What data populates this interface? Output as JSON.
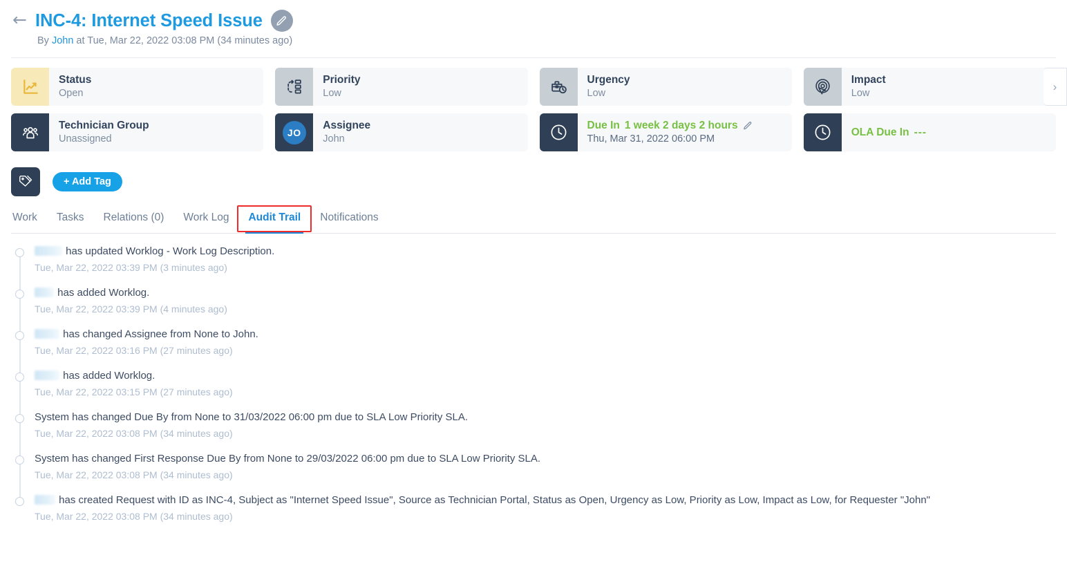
{
  "header": {
    "back_icon": "arrow-left-icon",
    "title": "INC-4: Internet Speed Issue",
    "edit_icon": "pencil-icon",
    "byline_prefix": "By ",
    "byline_author": "John",
    "byline_suffix": " at Tue, Mar 22, 2022 03:08 PM (34 minutes ago)"
  },
  "cards": {
    "row1": [
      {
        "icon": "chart-line-icon",
        "label": "Status",
        "value": "Open",
        "icon_bg": "ic-yellow"
      },
      {
        "icon": "priority-flow-icon",
        "label": "Priority",
        "value": "Low",
        "icon_bg": "ic-grey"
      },
      {
        "icon": "briefcase-clock-icon",
        "label": "Urgency",
        "value": "Low",
        "icon_bg": "ic-grey"
      },
      {
        "icon": "target-cursor-icon",
        "label": "Impact",
        "value": "Low",
        "icon_bg": "ic-grey"
      }
    ],
    "row2": {
      "technician_group": {
        "icon": "users-group-icon",
        "label": "Technician Group",
        "value": "Unassigned"
      },
      "assignee": {
        "icon": "avatar-initials",
        "initials": "JO",
        "label": "Assignee",
        "value": "John"
      },
      "due_in": {
        "icon": "clock-icon",
        "label": "Due In",
        "duration": "1 week 2 days 2 hours",
        "edit_icon": "pencil-icon",
        "value": "Thu, Mar 31, 2022 06:00 PM"
      },
      "ola_due_in": {
        "icon": "clock-icon",
        "label": "OLA Due In",
        "duration": "---"
      }
    },
    "scroll_next_icon": "chevron-right-icon"
  },
  "tags": {
    "tag_icon": "tag-icon",
    "add_tag_label": "+ Add Tag"
  },
  "tabs": [
    {
      "label": "Work",
      "active": false
    },
    {
      "label": "Tasks",
      "active": false
    },
    {
      "label": "Relations (0)",
      "active": false
    },
    {
      "label": "Work Log",
      "active": false
    },
    {
      "label": "Audit Trail",
      "active": true
    },
    {
      "label": "Notifications",
      "active": false
    }
  ],
  "audit_trail": [
    {
      "redacted_width": 40,
      "text": "has updated Worklog - Work Log Description.",
      "time": "Tue, Mar 22, 2022 03:39 PM (3 minutes ago)"
    },
    {
      "redacted_width": 28,
      "text": "has added Worklog.",
      "time": "Tue, Mar 22, 2022 03:39 PM (4 minutes ago)"
    },
    {
      "redacted_width": 36,
      "text": "has changed Assignee from None to John.",
      "time": "Tue, Mar 22, 2022 03:16 PM (27 minutes ago)"
    },
    {
      "redacted_width": 36,
      "text": "has added Worklog.",
      "time": "Tue, Mar 22, 2022 03:15 PM (27 minutes ago)"
    },
    {
      "redacted_width": 0,
      "text": "System has changed Due By from None to 31/03/2022 06:00 pm due to SLA Low Priority SLA.",
      "time": "Tue, Mar 22, 2022 03:08 PM (34 minutes ago)"
    },
    {
      "redacted_width": 0,
      "text": "System has changed First Response Due By from None to 29/03/2022 06:00 pm due to SLA Low Priority SLA.",
      "time": "Tue, Mar 22, 2022 03:08 PM (34 minutes ago)"
    },
    {
      "redacted_width": 30,
      "text": "has created Request with ID as INC-4, Subject as \"Internet Speed Issue\", Source as Technician Portal, Status as Open, Urgency as Low, Priority as Low, Impact as Low, for Requester \"John\"",
      "time": "Tue, Mar 22, 2022 03:08 PM (34 minutes ago)"
    }
  ],
  "colors": {
    "accent_blue": "#1e9ae0",
    "green": "#78c043",
    "navy": "#2f4056",
    "yellow_bg": "#f7e9b8",
    "highlight_red": "#ef2a2a"
  }
}
